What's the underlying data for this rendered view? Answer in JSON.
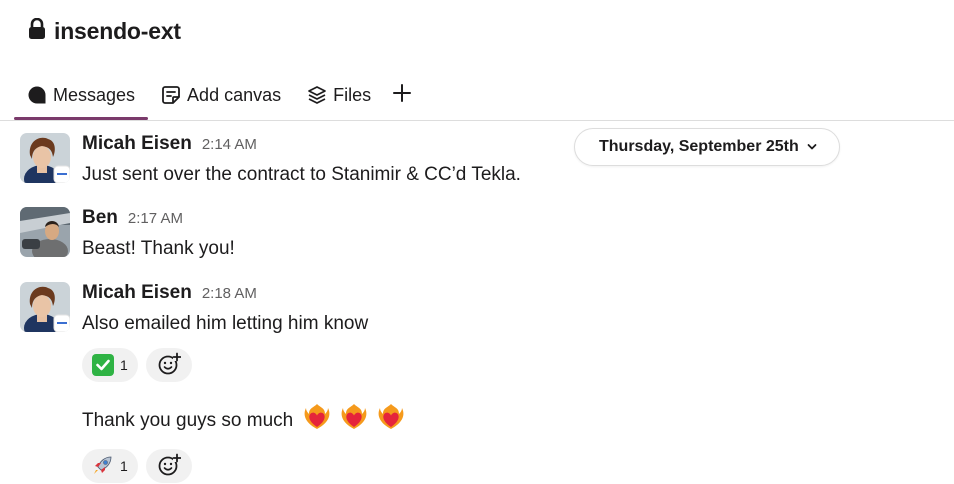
{
  "channel": {
    "name": "insendo-ext",
    "private_icon": "lock-icon"
  },
  "tabs": [
    {
      "label": "Messages",
      "icon": "message-bubble-icon",
      "active": true
    },
    {
      "label": "Add canvas",
      "icon": "canvas-icon",
      "active": false
    },
    {
      "label": "Files",
      "icon": "files-stack-icon",
      "active": false
    }
  ],
  "date_divider": {
    "label": "Thursday, September 25th",
    "icon": "chevron-down-icon"
  },
  "messages": [
    {
      "author": "Micah Eisen",
      "time": "2:14 AM",
      "text": "Just sent over the contract to Stanimir & CC’d Tekla."
    },
    {
      "author": "Ben",
      "time": "2:17 AM",
      "text": "Beast! Thank you!"
    },
    {
      "author": "Micah Eisen",
      "time": "2:18 AM",
      "text": "Also emailed him letting him know",
      "reaction": {
        "emoji": "white-check-mark",
        "count": "1"
      },
      "followup_text": "Thank you guys so much",
      "followup_emojis": [
        "heart-on-fire",
        "heart-on-fire",
        "heart-on-fire"
      ],
      "followup_reaction": {
        "emoji": "rocket",
        "count": "1"
      }
    }
  ],
  "colors": {
    "accent_tab_underline": "#7a3a6b",
    "reaction_bg": "#f1f1f1",
    "timestamp": "#616061"
  }
}
